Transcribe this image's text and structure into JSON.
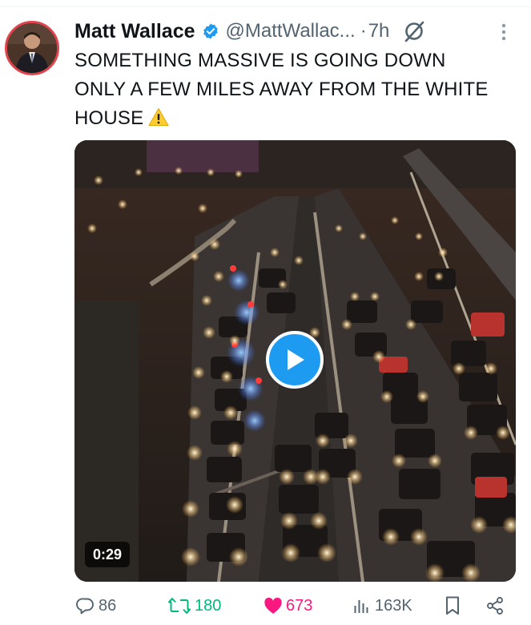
{
  "author": {
    "name": "Matt Wallace",
    "handle": "@MattWallac...",
    "time_sep": "·",
    "time": "7h"
  },
  "tweet": {
    "lines": [
      "SOMETHING MASSIVE IS GOING DOWN",
      "ONLY A FEW MILES AWAY FROM THE WHITE",
      "HOUSE"
    ]
  },
  "media": {
    "duration": "0:29",
    "play_icon": "play-icon"
  },
  "actions": {
    "replies": "86",
    "retweets": "180",
    "likes": "673",
    "views": "163K"
  },
  "colors": {
    "accent": "#1d9bf0",
    "like": "#f91880",
    "retweet": "#00ba7c",
    "muted": "#536471",
    "avatar_ring": "#e0444c"
  }
}
